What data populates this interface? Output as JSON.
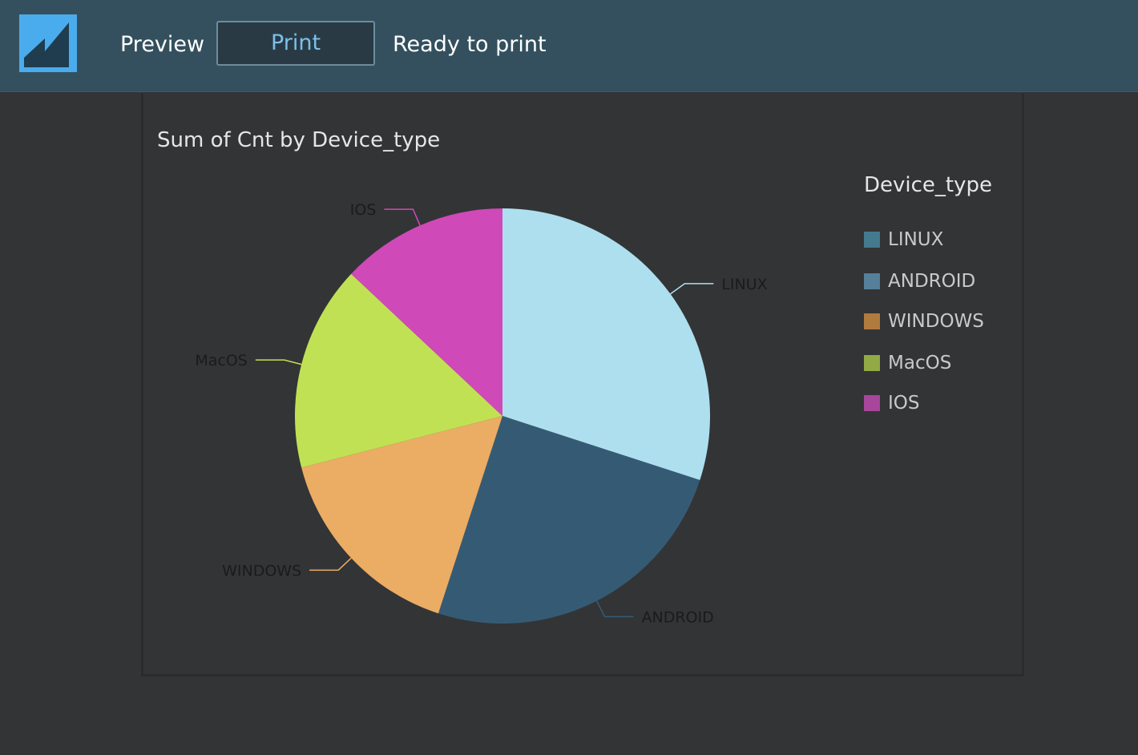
{
  "toolbar": {
    "preview_label": "Preview",
    "print_label": "Print",
    "status": "Ready to print"
  },
  "colors": {
    "topbar": "#34505e",
    "logo": "#4aacec",
    "background": "#333436"
  },
  "icons": {
    "logo": "app-logo-icon"
  },
  "chart_data": {
    "type": "pie",
    "title": "Sum of Cnt by Device_type",
    "legend_title": "Device_type",
    "legend_placement": "right",
    "categories": [
      "LINUX",
      "ANDROID",
      "WINDOWS",
      "MacOS",
      "IOS"
    ],
    "values": [
      30,
      25,
      16,
      16,
      13
    ],
    "slice_colors": [
      "#addfef",
      "#355b74",
      "#ebac64",
      "#c1e154",
      "#d049b8"
    ],
    "legend_colors": [
      "#44798e",
      "#567f99",
      "#b17a3e",
      "#91aa45",
      "#a7469a"
    ]
  }
}
